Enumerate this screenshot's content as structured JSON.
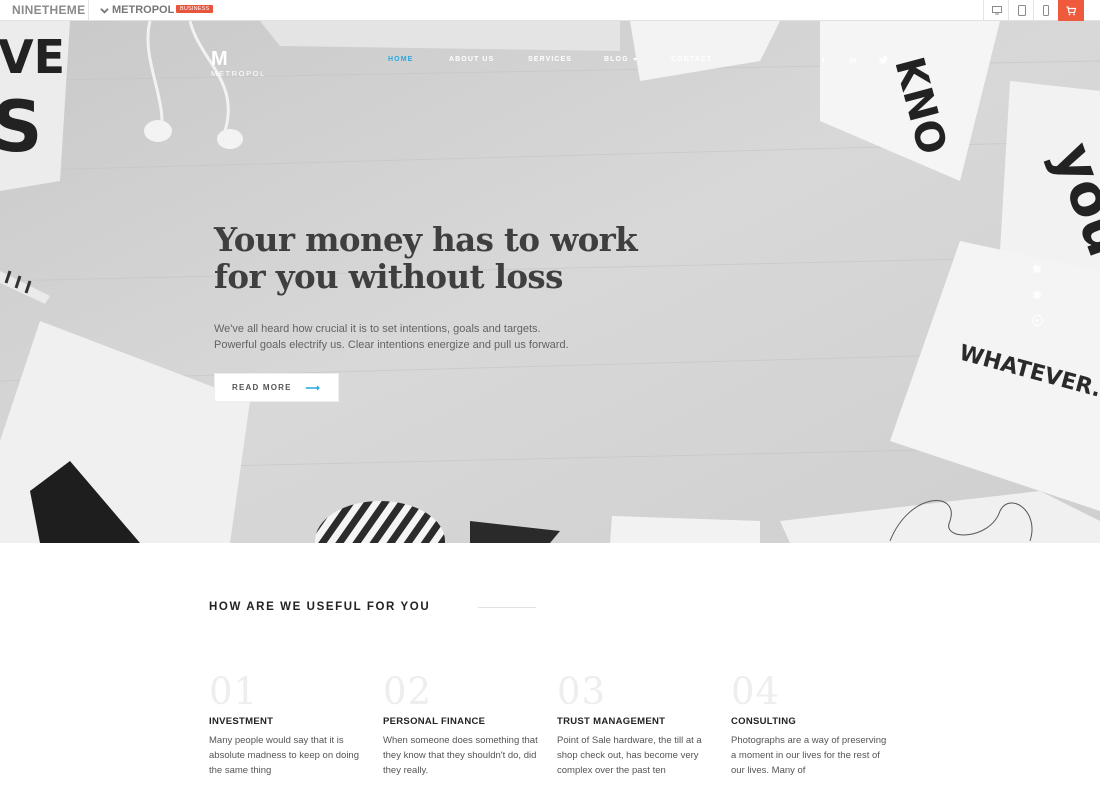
{
  "topbar": {
    "brand": "NINETHEME",
    "theme_name": "METROPOL",
    "badge": "BUSINESS",
    "devices": [
      "desktop-icon",
      "tablet-icon",
      "mobile-icon"
    ],
    "cart_icon": "cart-icon",
    "accent": "#ee5a3b"
  },
  "header": {
    "logo_mark": "M",
    "logo_text": "METROPOL",
    "nav": [
      "HOME",
      "ABOUT US",
      "SERVICES",
      "BLOG",
      "CONTACT"
    ],
    "active_nav": "HOME",
    "nav_accent": "#29a8e0",
    "social": [
      "f",
      "in",
      "twitter-icon"
    ]
  },
  "hero": {
    "title_line1": "Your money has to work",
    "title_line2": "for you without loss",
    "subtitle_line1": "We've all heard how crucial it is to set intentions, goals and targets.",
    "subtitle_line2": "Powerful goals electrify us. Clear intentions energize and pull us forward.",
    "cta": "READ MORE",
    "cta_arrow": "⟶",
    "slides": 3,
    "active_slide": 3
  },
  "services": {
    "title": "HOW ARE WE USEFUL FOR YOU",
    "items": [
      {
        "num": "01",
        "title": "INVESTMENT",
        "text": "Many people would say that it is absolute madness to keep on doing the same thing"
      },
      {
        "num": "02",
        "title": "PERSONAL FINANCE",
        "text": "When someone does something that they know that they shouldn't do, did they really."
      },
      {
        "num": "03",
        "title": "TRUST MANAGEMENT",
        "text": "Point of Sale hardware, the till at a shop check out, has become very complex over the past ten"
      },
      {
        "num": "04",
        "title": "CONSULTING",
        "text": "Photographs are a way of preserving a moment in our lives for the rest of our lives. Many of"
      }
    ]
  }
}
